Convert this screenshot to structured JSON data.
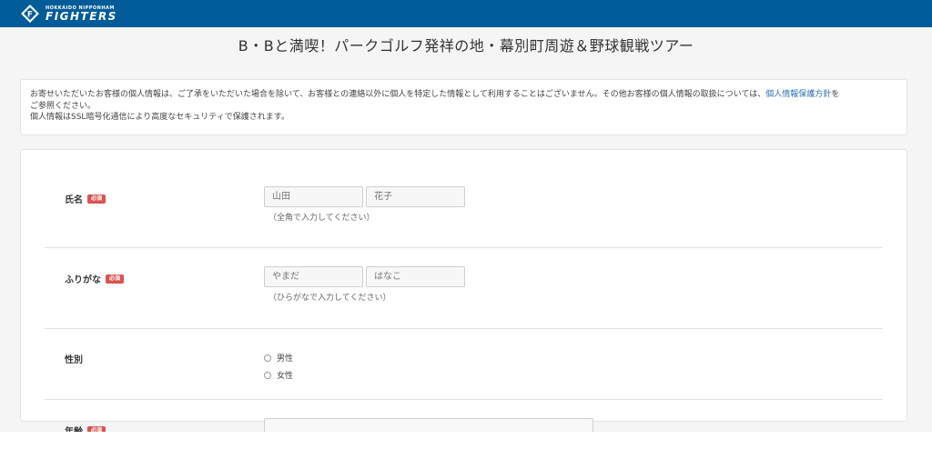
{
  "header": {
    "logo_small": "HOKKAIDO NIPPONHAM",
    "logo_big": "FIGHTERS",
    "icon": "fighters-f-logo-icon"
  },
  "page": {
    "title": "B・Bと満喫！パークゴルフ発祥の地・幕別町周遊＆野球観戦ツアー"
  },
  "notice": {
    "line1": "お寄せいただいたお客様の個人情報は、ご了承をいただいた場合を除いて、お客様との連絡以外に個人を特定した情報として利用することはございません。その他お客様の個人情報の取扱については、",
    "link": "個人情報保護方針",
    "line1_end": "を",
    "line2": "ご参照ください。",
    "line3": "個人情報はSSL暗号化通信により高度なセキュリティで保護されます。"
  },
  "form": {
    "required_label": "必須",
    "name": {
      "label": "氏名",
      "last_placeholder": "山田",
      "first_placeholder": "花子",
      "hint": "（全角で入力してください）"
    },
    "kana": {
      "label": "ふりがな",
      "last_placeholder": "やまだ",
      "first_placeholder": "はなこ",
      "hint": "（ひらがなで入力してください）"
    },
    "gender": {
      "label": "性別",
      "options": [
        "男性",
        "女性"
      ]
    },
    "age": {
      "label": "年齢"
    }
  },
  "colors": {
    "header_bg": "#005c98",
    "required_badge": "#d9534f",
    "link": "#2a6fb0"
  }
}
